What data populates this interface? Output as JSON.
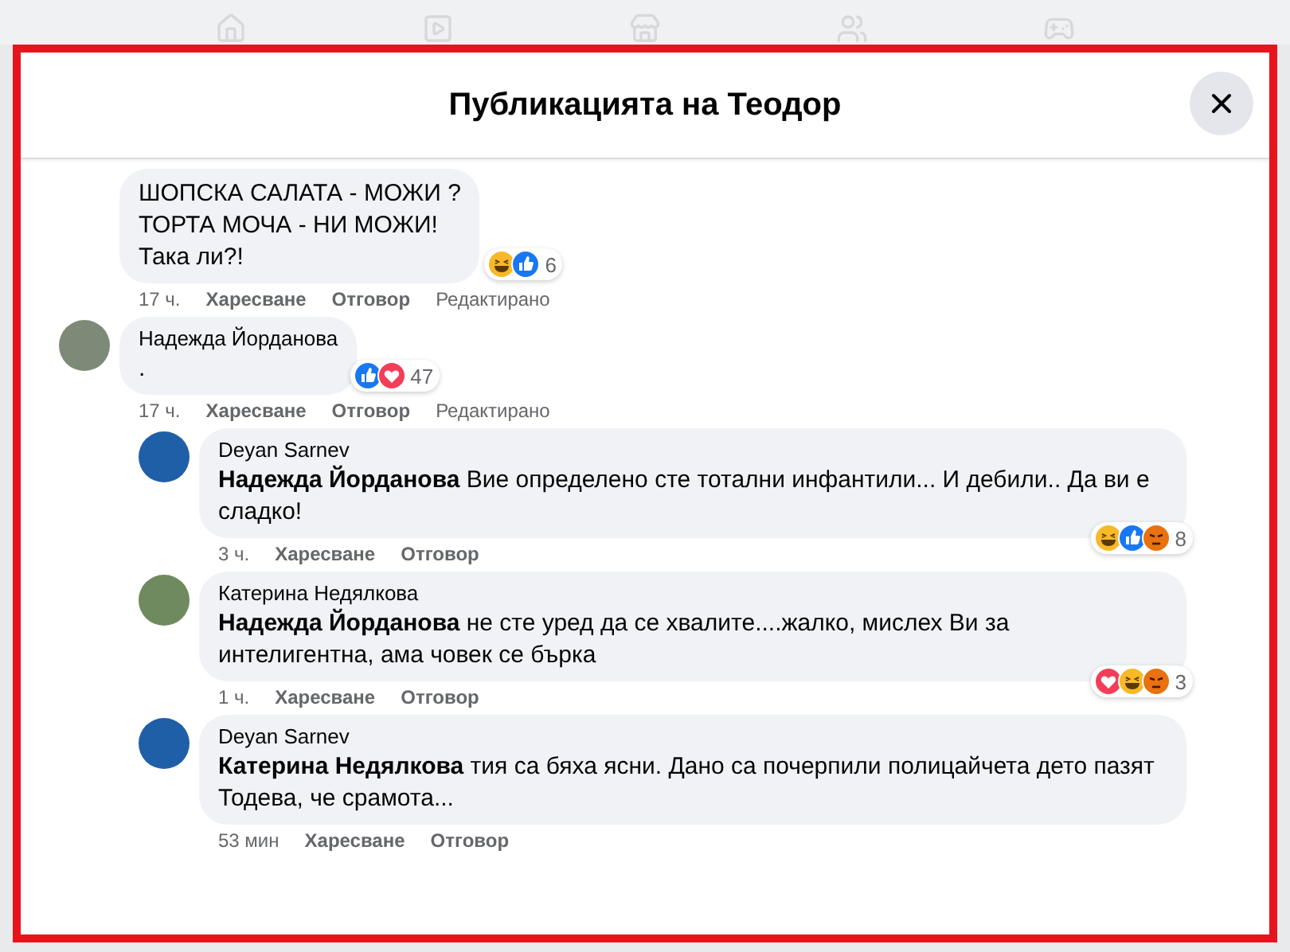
{
  "dialog": {
    "title": "Публикацията на Теодор"
  },
  "comments": [
    {
      "lines": [
        "ШОПСКА САЛАТА - МОЖИ ?",
        "ТОРТА МОЧА - НИ МОЖИ!",
        "Така ли?!"
      ],
      "reactions": [
        {
          "kind": "haha"
        },
        {
          "kind": "like"
        }
      ],
      "reaction_count": "6",
      "time": "17 ч.",
      "like": "Харесване",
      "reply": "Отговор",
      "edited": "Редактирано"
    },
    {
      "author": "Надежда Йорданова",
      "color": "#7d8a78",
      "lines": [
        "."
      ],
      "reactions": [
        {
          "kind": "like"
        },
        {
          "kind": "love"
        }
      ],
      "reaction_count": "47",
      "time": "17 ч.",
      "like": "Харесване",
      "reply": "Отговор",
      "edited": "Редактирано",
      "children": [
        {
          "author": "Deyan Sarnev",
          "color": "#1f5fa8",
          "lines": [
            "**Надежда Йорданова** Вие определено сте тотални инфантили... И дебили.. Да ви е сладко!"
          ],
          "reactions": [
            {
              "kind": "haha"
            },
            {
              "kind": "like"
            },
            {
              "kind": "angry"
            }
          ],
          "reaction_count": "8",
          "time": "3 ч.",
          "like": "Харесване",
          "reply": "Отговор"
        },
        {
          "author": "Катерина Недялкова",
          "color": "#6f8a5e",
          "lines": [
            "**Надежда Йорданова** не сте уред да се хвалите....жалко, мислех Ви за интелигентна, ама човек се бърка"
          ],
          "reactions": [
            {
              "kind": "love"
            },
            {
              "kind": "haha"
            },
            {
              "kind": "angry"
            }
          ],
          "reaction_count": "3",
          "time": "1 ч.",
          "like": "Харесване",
          "reply": "Отговор"
        },
        {
          "author": "Deyan Sarnev",
          "color": "#1f5fa8",
          "lines": [
            "**Катерина Недялкова** тия са бяха ясни. Дано са почерпили полицайчета дето пазят Тодева, че срамота..."
          ],
          "time": "53 мин",
          "like": "Харесване",
          "reply": "Отговор"
        }
      ]
    }
  ]
}
